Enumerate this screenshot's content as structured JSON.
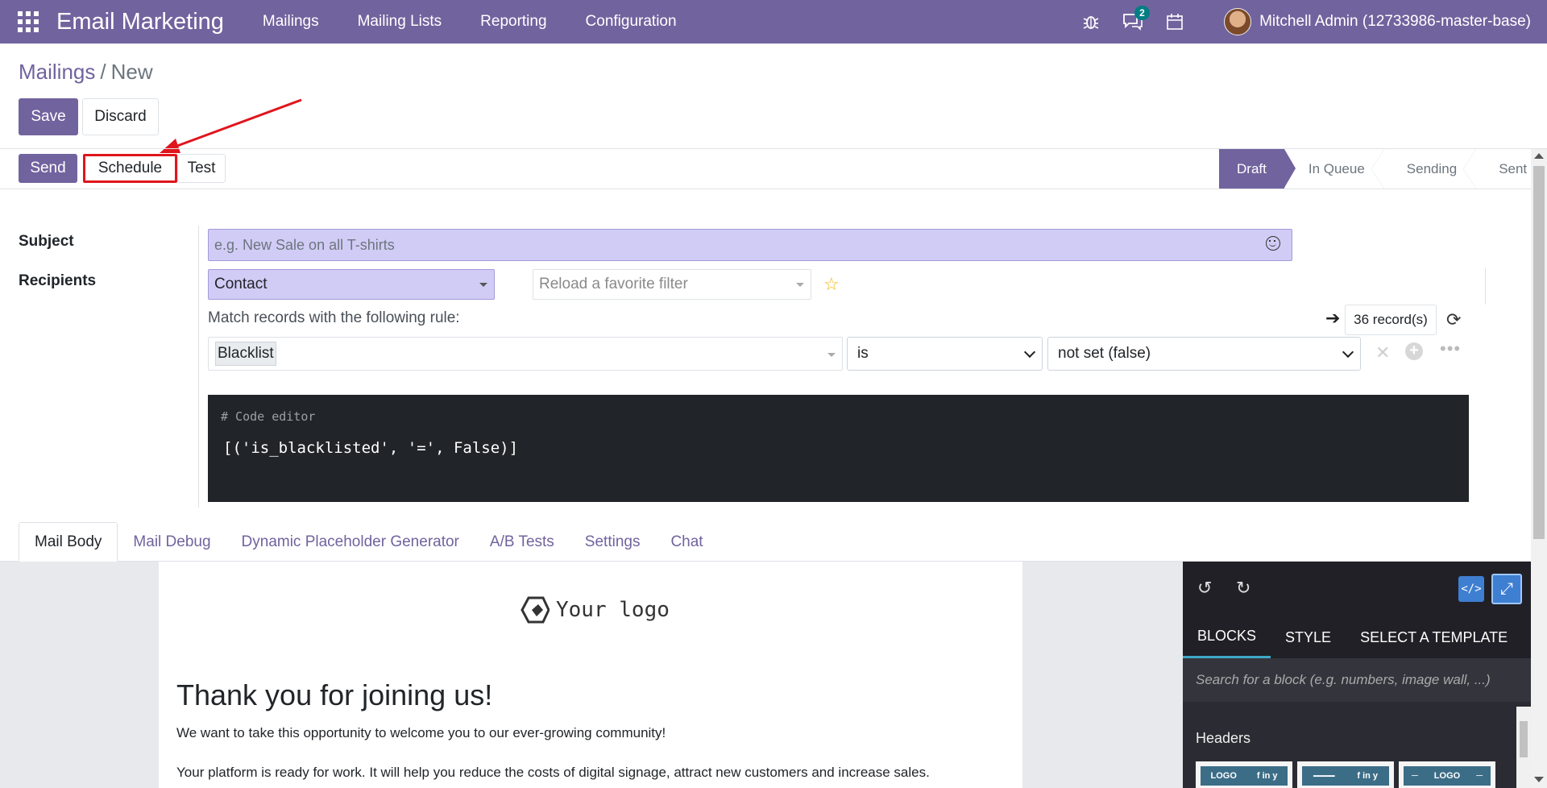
{
  "navbar": {
    "app_title": "Email Marketing",
    "menu": [
      "Mailings",
      "Mailing Lists",
      "Reporting",
      "Configuration"
    ],
    "messages_badge": "2",
    "user_name": "Mitchell Admin (12733986-master-base)",
    "color": "#71639e"
  },
  "breadcrumb": {
    "parent": "Mailings",
    "separator": "/",
    "current": "New"
  },
  "buttons": {
    "save": "Save",
    "discard": "Discard",
    "send": "Send",
    "schedule": "Schedule",
    "test": "Test"
  },
  "statusbar": {
    "stages": [
      "Draft",
      "In Queue",
      "Sending",
      "Sent"
    ],
    "active": "Draft"
  },
  "form": {
    "subject_label": "Subject",
    "subject_placeholder": "e.g. New Sale on all T-shirts",
    "recipients_label": "Recipients",
    "recipients_model": "Contact",
    "favorite_filter_placeholder": "Reload a favorite filter",
    "match_text": "Match records with the following rule:",
    "records_count": "36 record(s)",
    "rule": {
      "field": "Blacklist",
      "operator": "is",
      "value": "not set (false)"
    },
    "code_editor": {
      "comment": "# Code editor",
      "code": "[('is_blacklisted', '=', False)]"
    }
  },
  "tabs": [
    "Mail Body",
    "Mail Debug",
    "Dynamic Placeholder Generator",
    "A/B Tests",
    "Settings",
    "Chat"
  ],
  "active_tab": "Mail Body",
  "mail_body": {
    "logo_text": "Your logo",
    "title": "Thank you for joining us!",
    "paragraph1": "We want to take this opportunity to welcome you to our ever-growing community!",
    "paragraph2": "Your platform is ready for work. It will help you reduce the costs of digital signage, attract new customers and increase sales."
  },
  "editor_panel": {
    "tabs": [
      "BLOCKS",
      "STYLE",
      "SELECT A TEMPLATE"
    ],
    "search_placeholder": "Search for a block (e.g. numbers, image wall, ...)",
    "section_title": "Headers",
    "thumb_labels": [
      "LOGO",
      "f in y"
    ]
  },
  "annotation": {
    "color": "#e0151c"
  }
}
